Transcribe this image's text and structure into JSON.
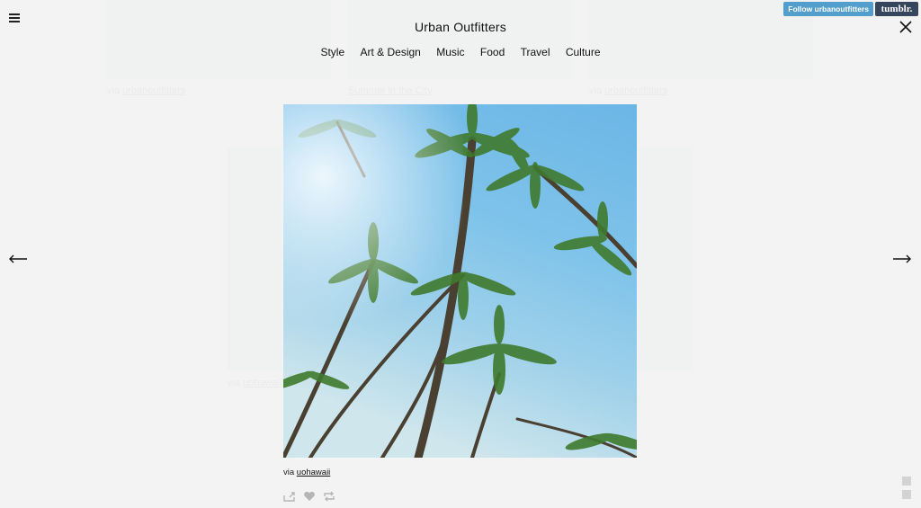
{
  "header": {
    "title": "Urban Outfitters",
    "nav": [
      "Style",
      "Art & Design",
      "Music",
      "Food",
      "Travel",
      "Culture"
    ],
    "follow_label": "Follow urbanoutfitters",
    "tumblr_label": "tumblr."
  },
  "background": {
    "captions": [
      {
        "prefix": "via",
        "link": "urbanoutfitters"
      },
      {
        "prefix": "",
        "link": "Summer in the City"
      },
      {
        "prefix": "via",
        "link": "urbanoutfitters"
      },
      {
        "prefix": "via",
        "link": "uohawaii"
      }
    ]
  },
  "post": {
    "caption_prefix": "via",
    "caption_link": "uohawaii",
    "image_subject": "palm trees against blue sky"
  },
  "icons": {
    "menu": "hamburger-menu-icon",
    "close": "close-icon",
    "prev": "arrow-left-icon",
    "next": "arrow-right-icon",
    "share": "share-icon",
    "like": "heart-icon",
    "reblog": "reblog-icon"
  },
  "colors": {
    "page_bg": "#f3f3f3",
    "follow_bg": "#529ecc",
    "tumblr_bg": "#36465d",
    "action_icons": "#b5b5b5"
  }
}
